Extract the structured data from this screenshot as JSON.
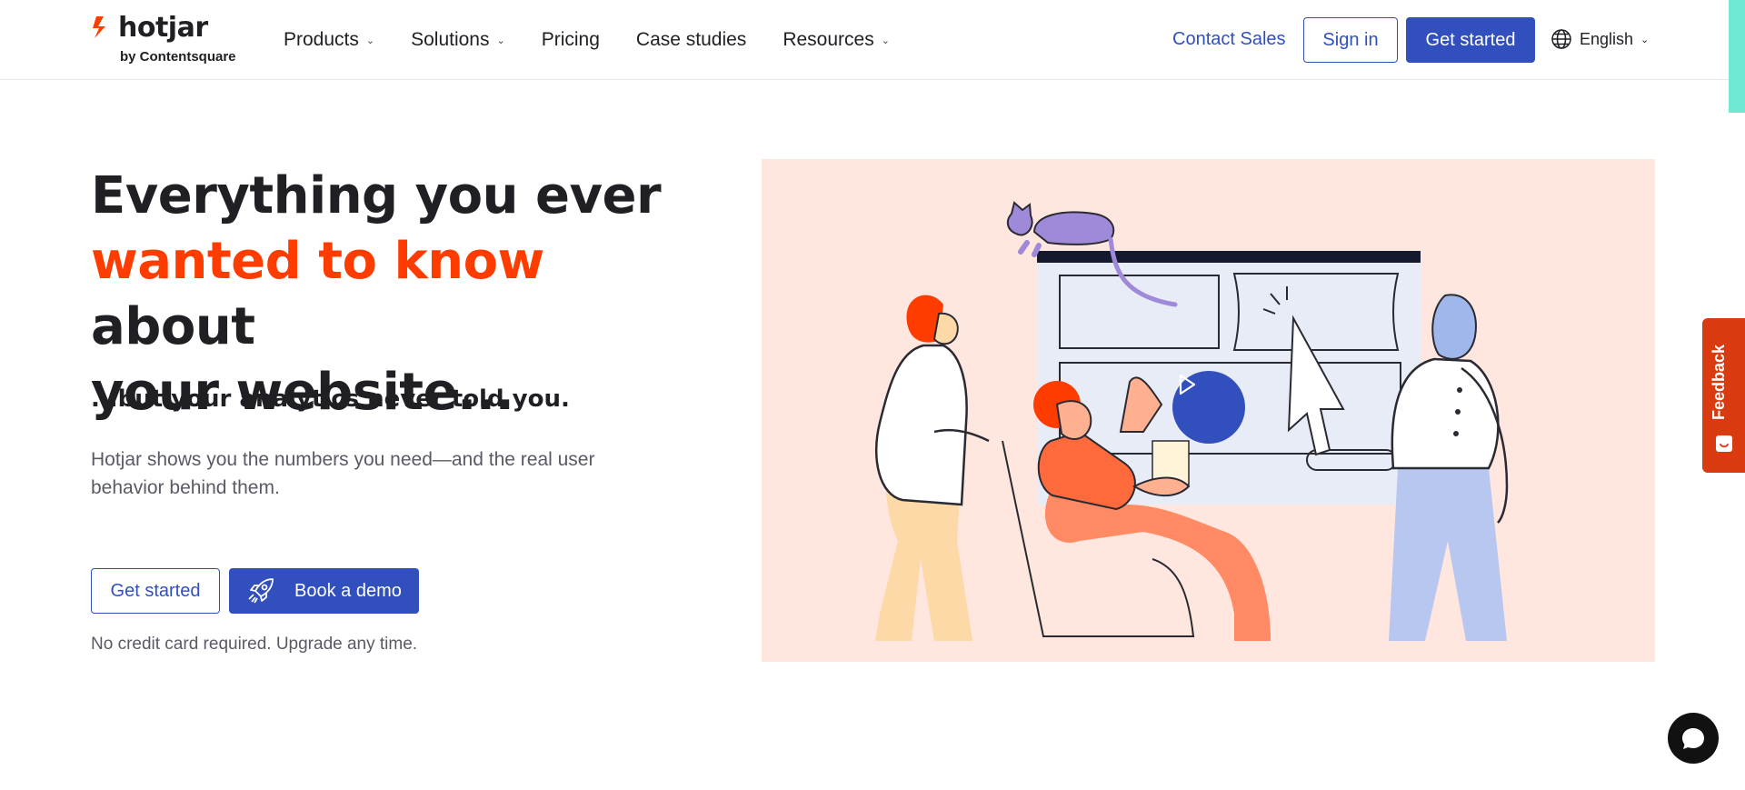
{
  "header": {
    "logo": {
      "word": "hotjar",
      "sub": "by Contentsquare"
    },
    "nav": [
      {
        "label": "Products",
        "has_dropdown": true
      },
      {
        "label": "Solutions",
        "has_dropdown": true
      },
      {
        "label": "Pricing",
        "has_dropdown": false
      },
      {
        "label": "Case studies",
        "has_dropdown": false
      },
      {
        "label": "Resources",
        "has_dropdown": true
      }
    ],
    "contact_sales": "Contact Sales",
    "sign_in": "Sign in",
    "get_started": "Get started",
    "language": "English"
  },
  "hero": {
    "title_line1": "Everything you ever",
    "title_highlight": "wanted to know",
    "title_after_highlight": " about",
    "title_line3": "your website...",
    "subtitle": "...but your analytics never told you.",
    "description": "Hotjar shows you the numbers you need—and the real user behavior behind them.",
    "get_started": "Get started",
    "book_demo": "Book a demo",
    "note": "No credit card required. Upgrade any time."
  },
  "feedback": {
    "label": "Feedback"
  },
  "icons": {
    "logo": "hotjar-logo-icon",
    "globe": "globe-icon",
    "chevron": "chevron-down-icon",
    "rocket": "rocket-icon",
    "play": "play-icon",
    "chat": "chat-bubble-icon",
    "feedback": "feedback-smile-icon"
  },
  "colors": {
    "brand_blue": "#324fbe",
    "highlight_orange": "#ff3c00",
    "illustration_bg": "#ffe6df",
    "feedback_red": "#d93a0f",
    "teal_accent": "#6fe9d2"
  }
}
